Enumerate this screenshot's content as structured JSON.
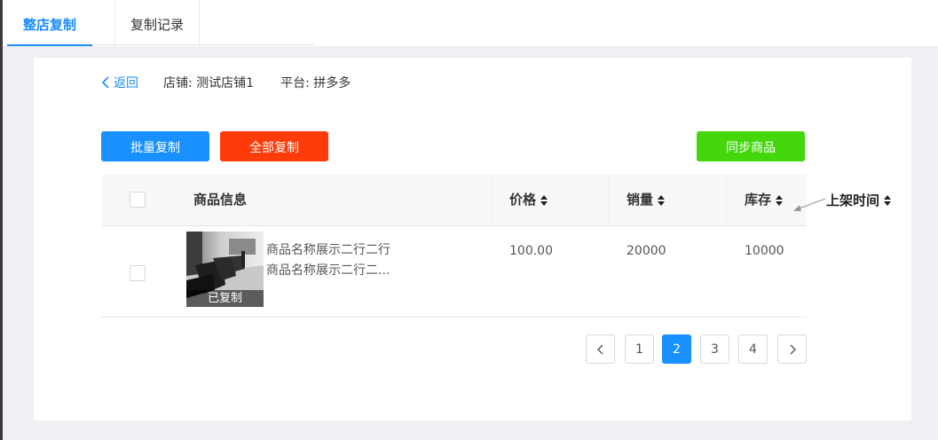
{
  "tabs": [
    {
      "label": "整店复制",
      "active": true
    },
    {
      "label": "复制记录",
      "active": false
    }
  ],
  "breadcrumb": {
    "back_label": "返回",
    "store_label": "店铺:",
    "store_value": "测试店铺1",
    "platform_label": "平台:",
    "platform_value": "拼多多"
  },
  "actions": {
    "batch_copy": "批量复制",
    "copy_all": "全部复制",
    "sync_products": "同步商品"
  },
  "table": {
    "columns": {
      "product_info": "商品信息",
      "price": "价格",
      "sales": "销量",
      "stock": "库存",
      "listing_time": "上架时间"
    },
    "rows": [
      {
        "name_line1": "商品名称展示二行二行",
        "name_line2": "商品名称展示二行二...",
        "badge": "已复制",
        "price": "100.00",
        "sales": "20000",
        "stock": "10000"
      }
    ]
  },
  "pagination": {
    "pages": [
      "1",
      "2",
      "3",
      "4"
    ],
    "current": "2"
  },
  "colors": {
    "primary": "#1890ff",
    "danger": "#ff3b0a",
    "success": "#44d80c"
  }
}
